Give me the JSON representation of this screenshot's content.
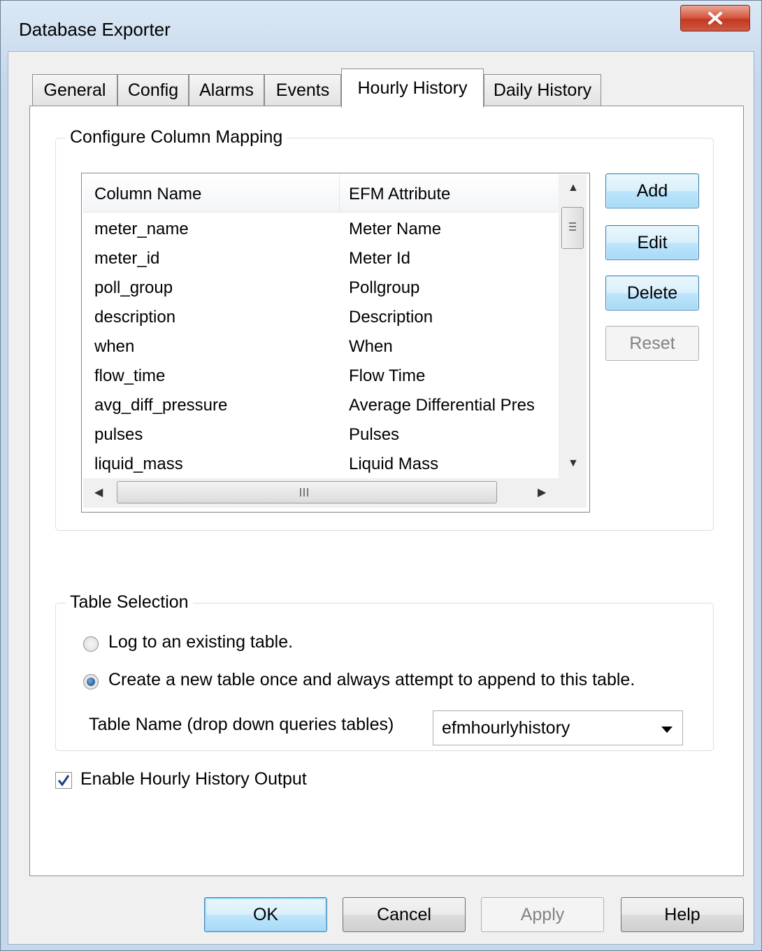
{
  "window": {
    "title": "Database Exporter",
    "close_label": "x"
  },
  "tabs": [
    {
      "label": "General",
      "active": false
    },
    {
      "label": "Config",
      "active": false
    },
    {
      "label": "Alarms",
      "active": false
    },
    {
      "label": "Events",
      "active": false
    },
    {
      "label": "Hourly History",
      "active": true
    },
    {
      "label": "Daily History",
      "active": false
    }
  ],
  "column_mapping": {
    "caption": "Configure Column Mapping",
    "headers": [
      "Column Name",
      "EFM Attribute"
    ],
    "rows": [
      [
        "meter_name",
        "Meter Name"
      ],
      [
        "meter_id",
        "Meter Id"
      ],
      [
        "poll_group",
        "Pollgroup"
      ],
      [
        "description",
        "Description"
      ],
      [
        "when",
        "When"
      ],
      [
        "flow_time",
        "Flow Time"
      ],
      [
        "avg_diff_pressure",
        "Average Differential Pres"
      ],
      [
        "pulses",
        "Pulses"
      ],
      [
        "liquid_mass",
        "Liquid Mass"
      ]
    ],
    "buttons": {
      "add": "Add",
      "edit": "Edit",
      "delete": "Delete",
      "reset": "Reset"
    }
  },
  "table_selection": {
    "caption": "Table Selection",
    "option_existing": "Log to an existing table.",
    "option_create": "Create a new table once and always attempt to append to this table.",
    "selected": "create",
    "table_name_label": "Table Name (drop down queries tables)",
    "table_name_value": "efmhourlyhistory"
  },
  "enable_output": {
    "label": "Enable Hourly History Output",
    "checked": true
  },
  "footer": {
    "ok": "OK",
    "cancel": "Cancel",
    "apply": "Apply",
    "help": "Help"
  },
  "colors": {
    "accent_border": "#3c7fb1",
    "close_red": "#c0381f",
    "check_blue": "#0a3d7a"
  }
}
